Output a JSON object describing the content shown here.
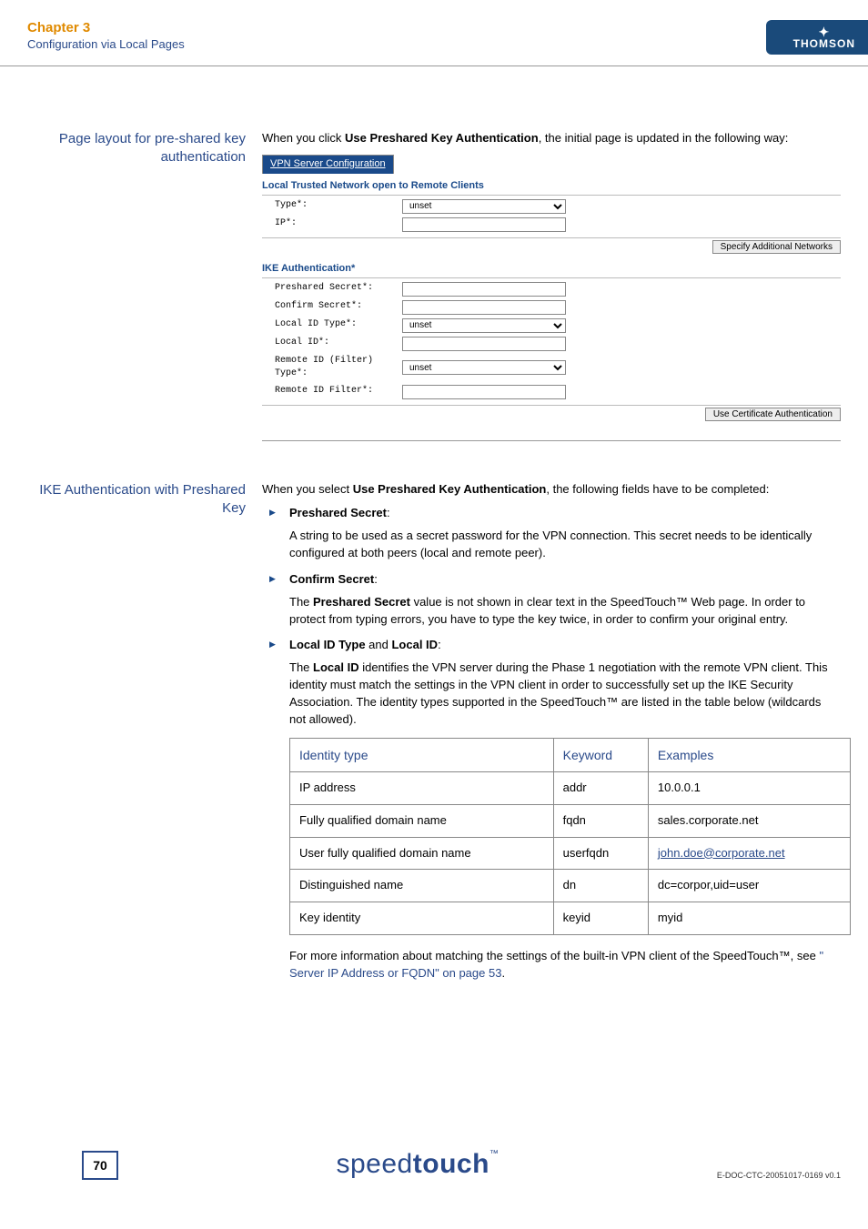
{
  "header": {
    "chapter": "Chapter 3",
    "subtitle": "Configuration via Local Pages",
    "brand": "THOMSON"
  },
  "section1": {
    "side": "Page layout for pre-shared key authentication",
    "intro_pre": "When you click ",
    "intro_bold": "Use Preshared Key Authentication",
    "intro_post": ", the initial page is updated in the following way:",
    "form": {
      "tab": "VPN Server Configuration",
      "section_a": "Local Trusted Network open to Remote Clients",
      "row1_label": "Type*:",
      "row1_value": "unset",
      "row2_label": "IP*:",
      "btn1": "Specify Additional Networks",
      "section_b": "IKE Authentication*",
      "r3": "Preshared Secret*:",
      "r4": "Confirm Secret*:",
      "r5": "Local ID Type*:",
      "r5_value": "unset",
      "r6": "Local ID*:",
      "r7": "Remote ID (Filter) Type*:",
      "r7_value": "unset",
      "r8": "Remote ID Filter*:",
      "btn2": "Use Certificate Authentication"
    }
  },
  "section2": {
    "side": "IKE Authentication with Preshared Key",
    "intro_pre": "When you select ",
    "intro_bold": "Use Preshared Key Authentication",
    "intro_post": ", the following fields have to be completed:",
    "items": {
      "a_title": "Preshared Secret",
      "a_colon": ":",
      "a_body": "A string to be used as a secret password for the VPN connection. This secret needs to be identically configured at both peers (local and remote peer).",
      "b_title": "Confirm Secret",
      "b_colon": ":",
      "b_body_pre": "The ",
      "b_body_bold": "Preshared Secret",
      "b_body_post": " value is not shown in clear text in the SpeedTouch™ Web page. In order to protect from typing errors, you have to type the key twice, in order to confirm your original entry.",
      "c_title_1": "Local ID Type",
      "c_title_mid": " and ",
      "c_title_2": "Local ID",
      "c_title_colon": ":",
      "c_body_pre": "The ",
      "c_body_bold": "Local ID",
      "c_body_post": " identifies the VPN server during the Phase 1 negotiation with the remote VPN client. This identity must match the settings in the VPN client in order to successfully set up the IKE Security Association. The identity types supported in the SpeedTouch™ are listed in the table below (wildcards not allowed)."
    },
    "table": {
      "h1": "Identity type",
      "h2": "Keyword",
      "h3": "Examples",
      "rows": [
        {
          "c1": "IP address",
          "c2": "addr",
          "c3": "10.0.0.1",
          "link": false
        },
        {
          "c1": "Fully qualified domain name",
          "c2": "fqdn",
          "c3": "sales.corporate.net",
          "link": false
        },
        {
          "c1": "User fully qualified domain name",
          "c2": "userfqdn",
          "c3": "john.doe@corporate.net",
          "link": true
        },
        {
          "c1": "Distinguished name",
          "c2": "dn",
          "c3": "dc=corpor,uid=user",
          "link": false
        },
        {
          "c1": "Key identity",
          "c2": "keyid",
          "c3": "myid",
          "link": false
        }
      ]
    },
    "after_pre": "For more information about matching the settings of the built-in VPN client of the SpeedTouch™, see ",
    "after_ref": "\" Server IP Address or FQDN\" on page 53",
    "after_post": "."
  },
  "footer": {
    "page": "70",
    "brand_light": "speed",
    "brand_heavy": "touch",
    "brand_tm": "™",
    "docid": "E-DOC-CTC-20051017-0169 v0.1"
  }
}
